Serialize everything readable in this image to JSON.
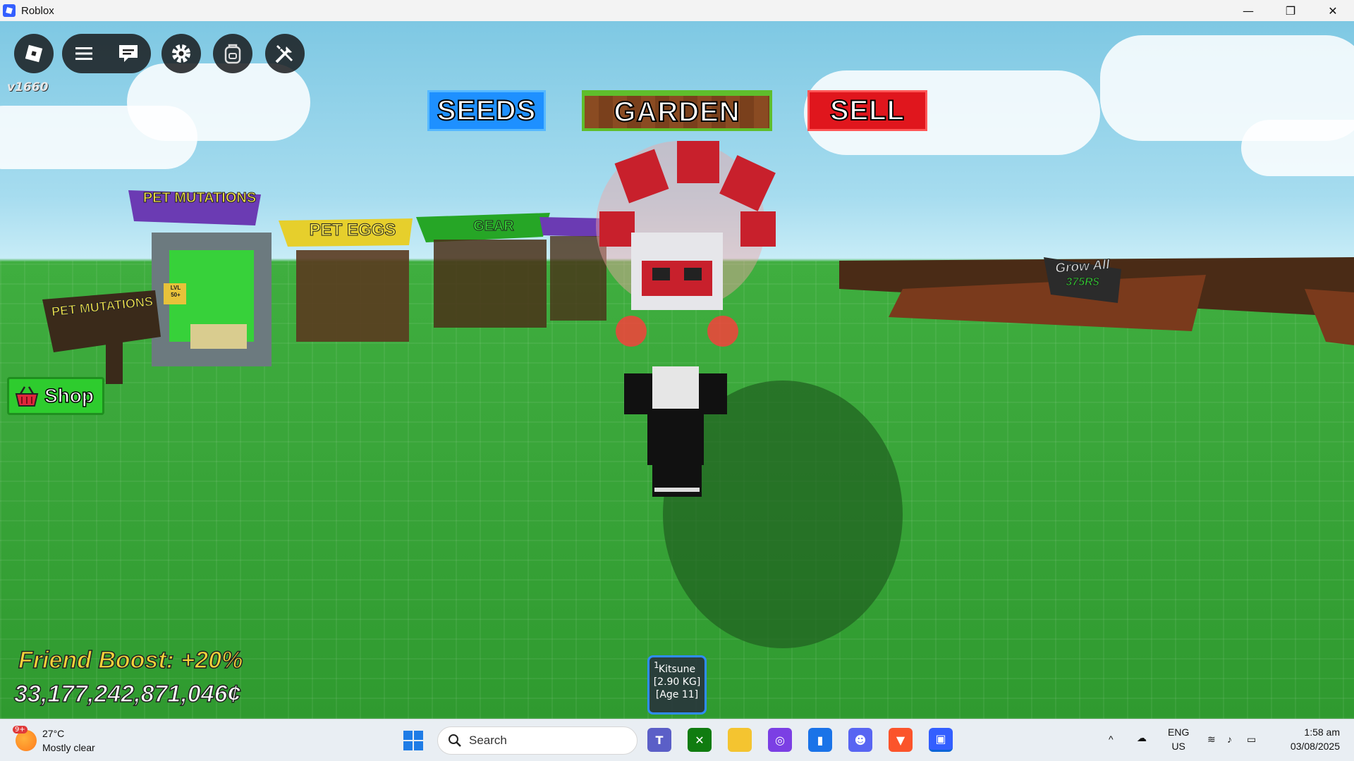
{
  "window": {
    "title": "Roblox",
    "controls": {
      "minimize": "—",
      "restore": "❐",
      "close": "✕"
    }
  },
  "hud": {
    "version": "v1660",
    "nav": {
      "seeds": "SEEDS",
      "garden": "GARDEN",
      "sell": "SELL"
    },
    "shop_label": "Shop",
    "friend_boost": "Friend Boost: +20%",
    "money": "33,177,242,871,046¢",
    "hotbar": [
      {
        "slot": "1",
        "name": "Kitsune",
        "weight": "[2.90 KG]",
        "age": "[Age 11]"
      }
    ]
  },
  "world_signs": {
    "pet_mutations_top": "PET MUTATIONS",
    "pet_mutations_board": "PET MUTATIONS",
    "lvl_tag": "LVL 50+",
    "pet_eggs": "PET EGGS",
    "gear": "GEAR",
    "grow_all": "Grow All",
    "grow_all_price": "375R$"
  },
  "taskbar": {
    "weather_temp": "27°C",
    "weather_desc": "Mostly clear",
    "weather_badge": "9+",
    "search_placeholder": "Search",
    "lang_top": "ENG",
    "lang_bottom": "US",
    "time": "1:58 am",
    "date": "03/08/2025"
  },
  "colors": {
    "seeds": "#1e90ff",
    "garden": "#8a4b22",
    "sell": "#e0161d",
    "shop": "#2ecc2e",
    "hotbar_border": "#2f8cff"
  }
}
